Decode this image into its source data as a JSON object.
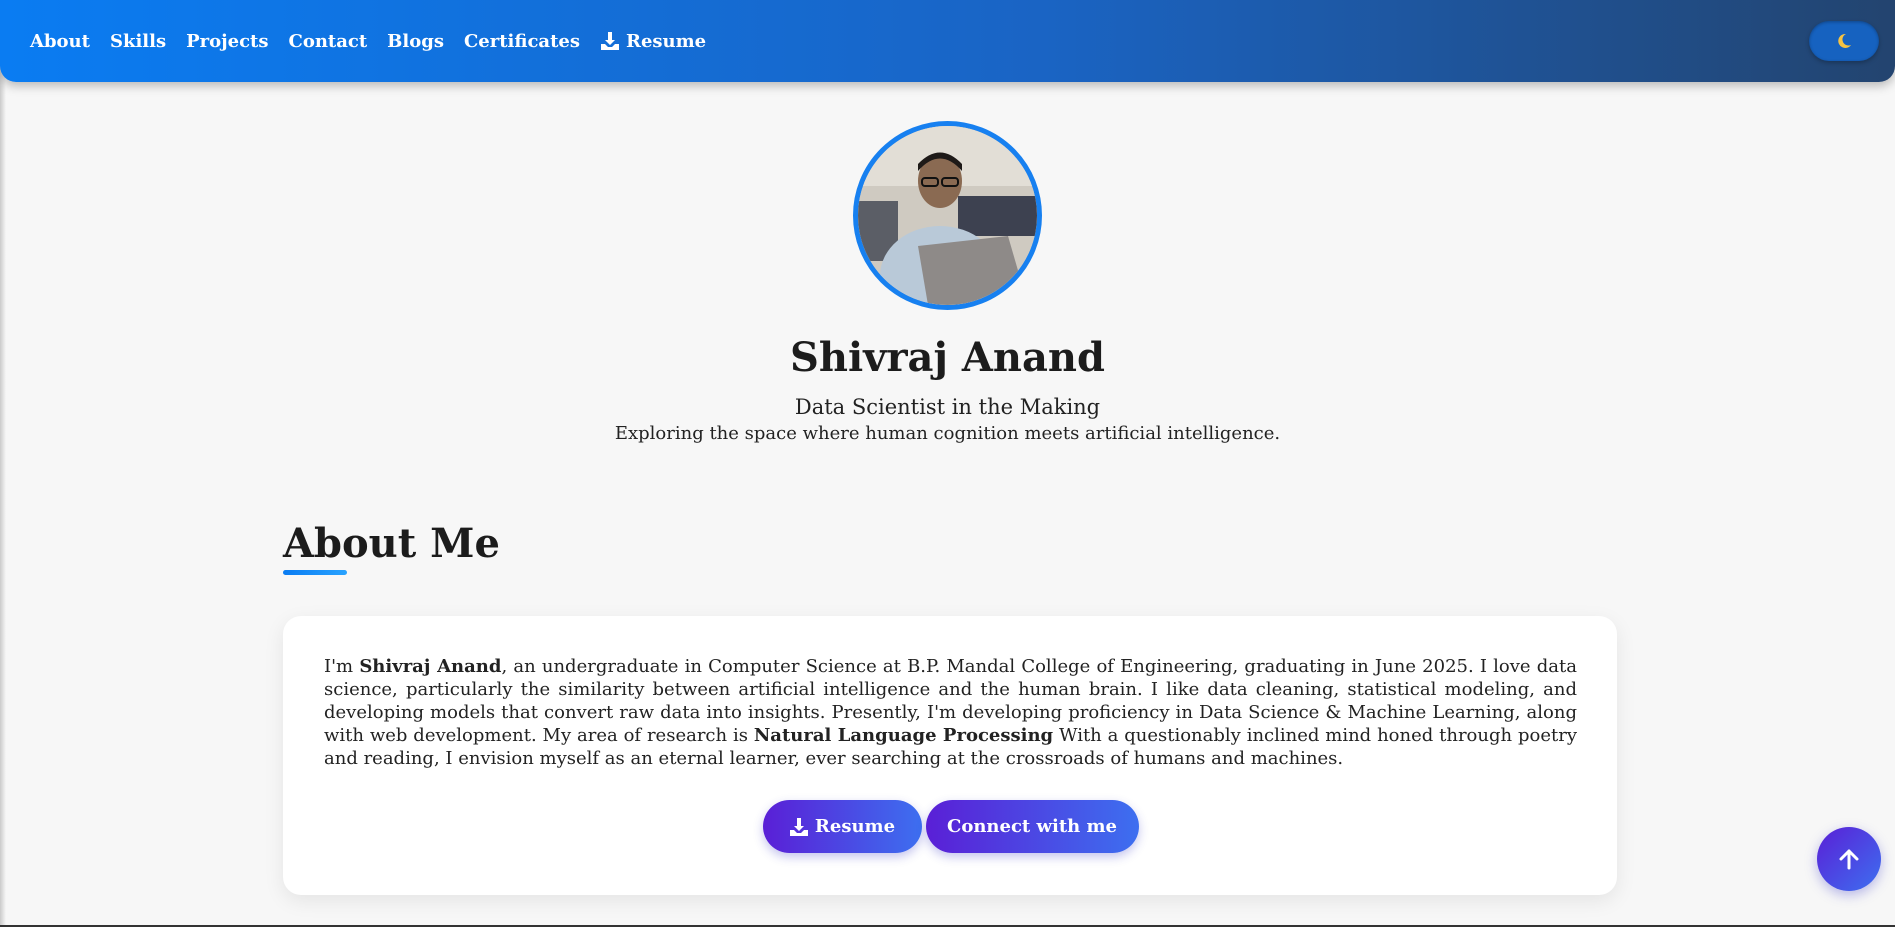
{
  "nav": {
    "items": [
      {
        "label": "About"
      },
      {
        "label": "Skills"
      },
      {
        "label": "Projects"
      },
      {
        "label": "Contact"
      },
      {
        "label": "Blogs"
      },
      {
        "label": "Certificates"
      },
      {
        "label": "Resume",
        "icon": "download-icon"
      }
    ],
    "theme_toggle_icon": "moon-icon"
  },
  "hero": {
    "name": "Shivraj Anand",
    "tagline": "Data Scientist in the Making",
    "subline": "Exploring the space where human cognition meets artificial intelligence."
  },
  "about": {
    "heading": "About Me",
    "intro_prefix": "I'm ",
    "intro_name": "Shivraj Anand",
    "intro_body": ", an undergraduate in Computer Science at B.P. Mandal College of Engineering, graduating in June 2025. I love data science, particularly the similarity between artificial intelligence and the human brain. I like data cleaning, statistical modeling, and developing models that convert raw data into insights. Presently, I'm developing proficiency in Data Science & Machine Learning, along with web development. My area of research is ",
    "research_area": "Natural Language Processing",
    "intro_tail": " With a questionably inclined mind honed through poetry and reading, I envision myself as an eternal learner, ever searching at the crossroads of humans and machines.",
    "resume_button": "Resume",
    "connect_button": "Connect with me"
  },
  "scroll_top_icon": "arrow-up-icon",
  "colors": {
    "nav_gradient_start": "#0a7cf2",
    "nav_gradient_end": "#23446f",
    "button_gradient_start": "#5a1fd6",
    "button_gradient_end": "#3d6ff0",
    "avatar_border": "#1780f0"
  }
}
